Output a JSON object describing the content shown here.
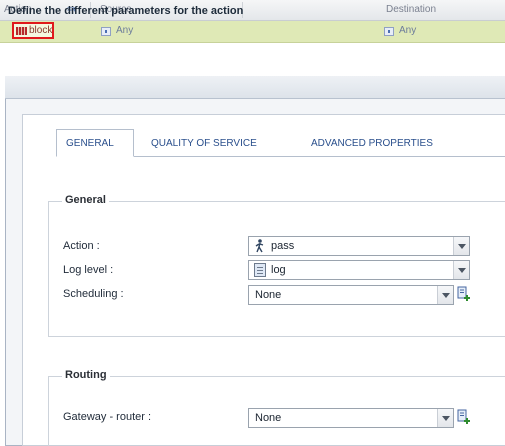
{
  "grid": {
    "columns": {
      "action": "Action",
      "source": "Source",
      "destination": "Destination"
    },
    "row": {
      "action": "block",
      "source": "Any",
      "destination": "Any"
    }
  },
  "dialog": {
    "title": "Define the different parameters for the action",
    "tabs": [
      {
        "label": "GENERAL",
        "active": true
      },
      {
        "label": "QUALITY OF SERVICE",
        "active": false
      },
      {
        "label": "ADVANCED PROPERTIES",
        "active": false
      }
    ],
    "general": {
      "legend": "General",
      "action_label": "Action :",
      "action_value": "pass",
      "loglevel_label": "Log level :",
      "loglevel_value": "log",
      "scheduling_label": "Scheduling :",
      "scheduling_value": "None"
    },
    "routing": {
      "legend": "Routing",
      "gateway_label": "Gateway - router :",
      "gateway_value": "None"
    }
  },
  "colors": {
    "row_highlight": "#dfe9b6",
    "selection_border": "#e0191c",
    "tab_text": "#2a4f8c"
  }
}
